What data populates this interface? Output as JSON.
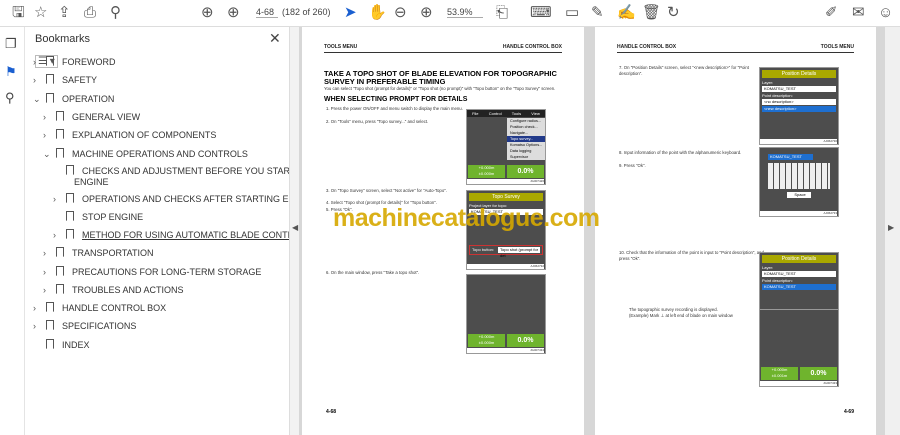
{
  "toolbar": {
    "page_input": "4-68",
    "page_count": "(182 of 260)",
    "zoom": "53.9%"
  },
  "bookmarks": {
    "title": "Bookmarks",
    "items": [
      {
        "label": "FOREWORD"
      },
      {
        "label": "SAFETY"
      },
      {
        "label": "OPERATION"
      },
      {
        "label": "GENERAL VIEW"
      },
      {
        "label": "EXPLANATION OF COMPONENTS"
      },
      {
        "label": "MACHINE OPERATIONS AND CONTROLS"
      },
      {
        "label": "CHECKS AND ADJUSTMENT BEFORE YOU START"
      },
      {
        "label": "ENGINE"
      },
      {
        "label": "OPERATIONS AND CHECKS AFTER STARTING ENGINE"
      },
      {
        "label": "STOP ENGINE"
      },
      {
        "label": "METHOD FOR USING AUTOMATIC BLADE CONTROL"
      },
      {
        "label": "TRANSPORTATION"
      },
      {
        "label": "PRECAUTIONS FOR LONG-TERM STORAGE"
      },
      {
        "label": "TROUBLES AND ACTIONS"
      },
      {
        "label": "HANDLE CONTROL BOX"
      },
      {
        "label": "SPECIFICATIONS"
      },
      {
        "label": "INDEX"
      }
    ]
  },
  "left_page": {
    "header_left": "TOOLS MENU",
    "header_right": "HANDLE CONTROL BOX",
    "title": "TAKE A TOPO SHOT OF BLADE ELEVATION FOR TOPOGRAPHIC SURVEY IN PREFERABLE TIMING",
    "intro": "You can select \"Topo shot (prompt for details)\" or \"Topo shot (no prompt)\" with \"Topo button\" on the \"Topo Survey\" screen.",
    "subtitle": "WHEN SELECTING PROMPT FOR DETAILS",
    "steps": [
      "1. Press the power ON/OFF and menu switch to display the main menu.",
      "2. On \"Tools\" menu, press \"Topo survey...\" and select.",
      "3. On \"Topo Survey\" screen, select \"Not active\" for \"Auto-Topo\".",
      "4. Select \"Topo shot (prompt for details)\" for \"Topo button\".",
      "5. Press \"Ok\".",
      "6. On the main window, press \"Take a topo shot\"."
    ],
    "menu": {
      "tabs": [
        "File",
        "Control",
        "Tools",
        "View"
      ],
      "items": [
        "Configure radios...",
        "Position check...",
        "Navigate...",
        "Topo survey...",
        "Komatsu Options...",
        "Data logging",
        "Supervisor"
      ]
    },
    "topo": {
      "title": "Topo Survey",
      "project_layer": "Project layer for topo:",
      "layer": "KOMATSU_TEST",
      "topo_button": "Topo button:",
      "topo_value": "Topo shot (prompt for det"
    },
    "readout": {
      "a": "+0.000m",
      "b": "±0.000m",
      "pct": "0.0%"
    },
    "codes": [
      "JG007426",
      "AJ062732",
      "JG007434"
    ],
    "page_number": "4-68"
  },
  "right_page": {
    "header_left": "HANDLE CONTROL BOX",
    "header_right": "TOOLS MENU",
    "steps": [
      "7. On \"Position Details\" screen, select \"<new description>\" for \"Point description\".",
      "8. Input information of the point with the alphanumeric keyboard.",
      "9. Press \"Ok\".",
      "10. Check that the information of the point is input to \"Point description\", and press \"Ok\"."
    ],
    "note1": "The topographic survey recording is displayed.",
    "note2": "(Example) Mark ⊥ at left end of blade on main window",
    "pos": {
      "title": "Position Details",
      "layer_label": "Layer:",
      "layer": "KOMATSU_TEST",
      "desc_label": "Point description:",
      "opt1": "<no description>",
      "opt2": "<new description>",
      "desc_value": "KOMATSU_TEST"
    },
    "kbd": {
      "input": "KOMATSU_TEST",
      "space": "Space"
    },
    "readout": {
      "a": "+0.000m",
      "b": "±0.001m",
      "pct": "0.0%"
    },
    "codes": [
      "AJ062730",
      "AJ062733",
      "AJ062736",
      "JG007433"
    ],
    "page_number": "4-69"
  },
  "watermark": "machinecatalogue.com"
}
